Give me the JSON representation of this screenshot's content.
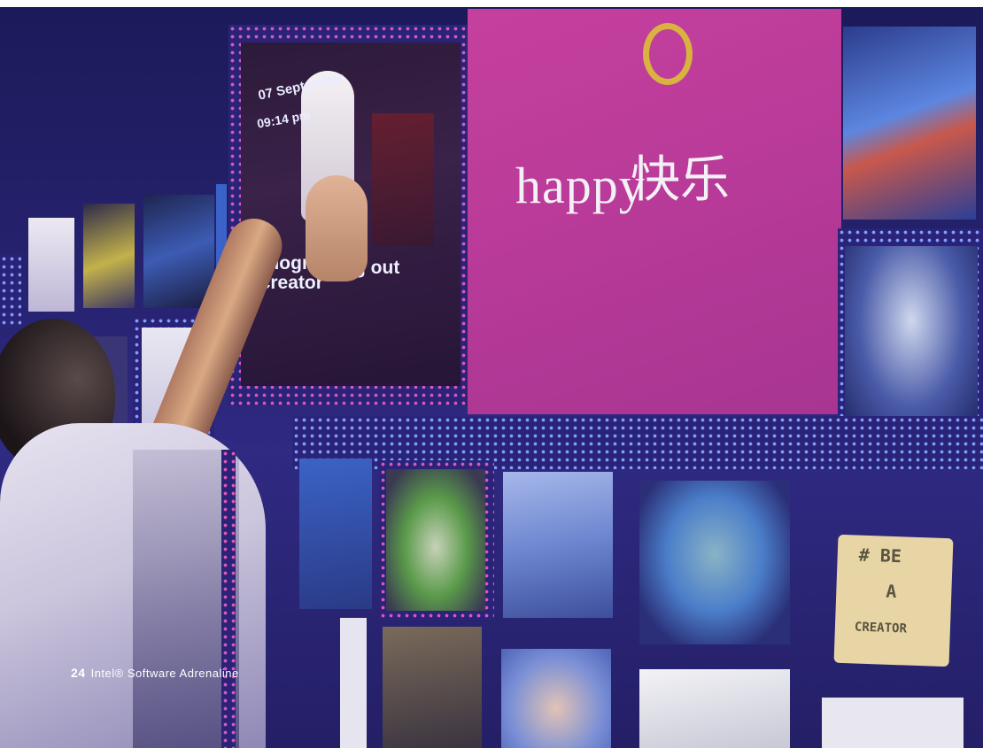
{
  "sign": {
    "word_latin": "happy",
    "word_chinese": "快乐"
  },
  "tweet": {
    "date": "07 September",
    "time": "09:14 pm",
    "handle": "@dogm",
    "hashtag": "#creator",
    "tail": "g out"
  },
  "note_card": {
    "line1": "# BE",
    "line2": "A",
    "line3": "CREATOR"
  },
  "footer": {
    "page_number": "24",
    "publication": "Intel® Software Adrenaline"
  },
  "colors": {
    "sign_pink": "#b83a98",
    "ring_gold": "#d9b23f",
    "wall_blue": "#26226e",
    "led_pink": "#d85bb8"
  }
}
